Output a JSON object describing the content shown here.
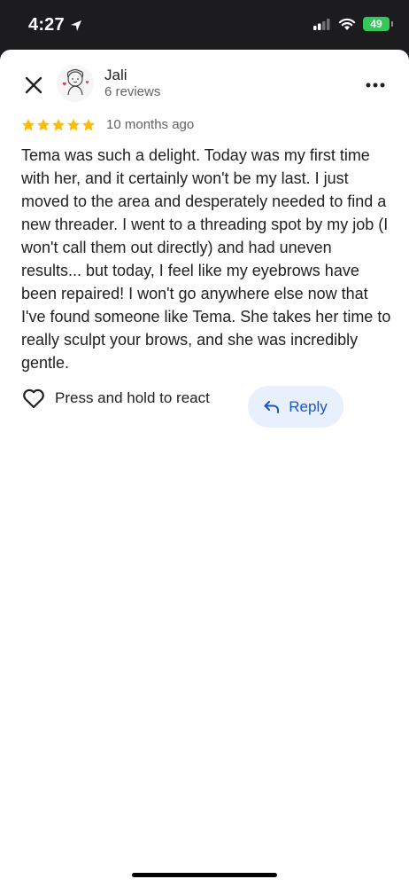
{
  "status_bar": {
    "time": "4:27",
    "battery": "49"
  },
  "review": {
    "reviewer_name": "Jali",
    "reviewer_count": "6 reviews",
    "rating": 5,
    "rating_max": 5,
    "star_color": "#fbbc04",
    "date": "10 months ago",
    "text": "Tema was such a delight. Today was my first time with her, and it certainly won't be my last. I just moved to the area and desperately needed to find a new threader. I went to a threading spot by my job (I won't call them out directly) and had uneven results... but today, I feel like my eyebrows have been repaired! I won't go anywhere else now that I've found someone like Tema. She takes her time to really sculpt your brows, and she was incredibly gentle."
  },
  "actions": {
    "react_label": "Press and hold to react",
    "reply_label": "Reply"
  },
  "colors": {
    "accent": "#1a56c4",
    "reply_bg": "#e8f0fe",
    "battery_green": "#34c759"
  },
  "icons": {
    "close": "close-icon",
    "more": "more-horizontal-icon",
    "heart": "heart-outline-icon",
    "reply": "reply-arrow-icon",
    "location": "location-arrow-icon",
    "signal": "signal-icon",
    "wifi": "wifi-icon"
  }
}
